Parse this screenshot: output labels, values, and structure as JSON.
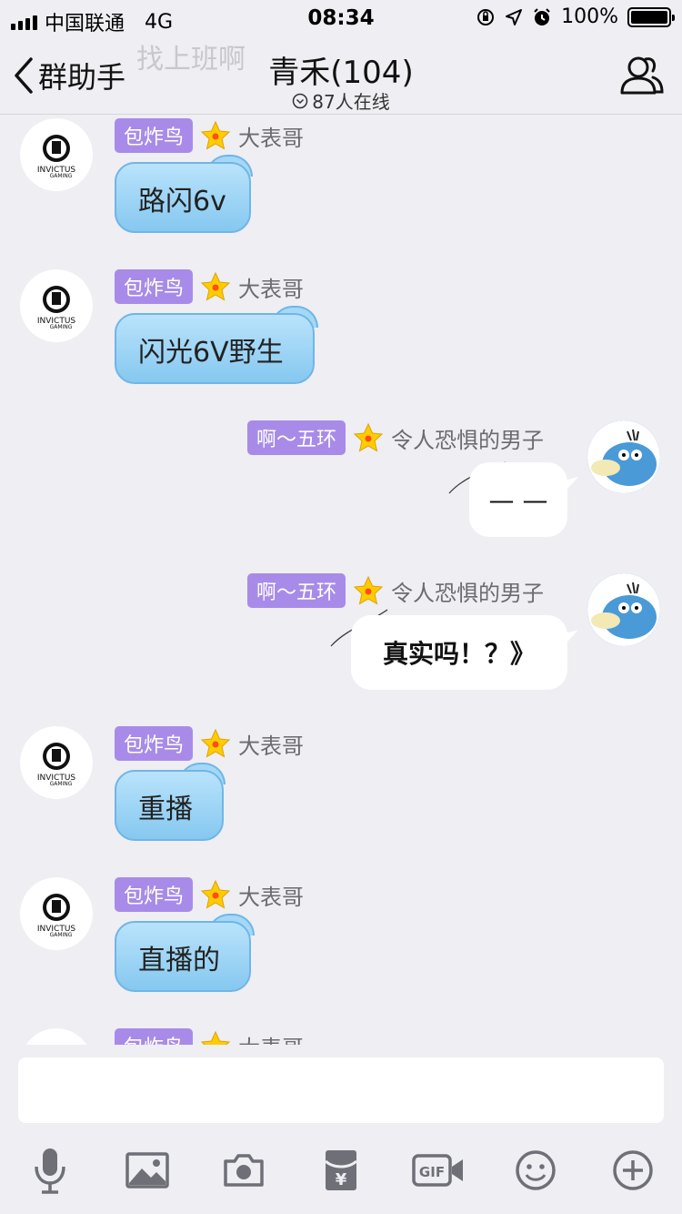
{
  "status_bar": {
    "carrier": "中国联通",
    "network": "4G",
    "time": "08:34",
    "battery": "100%"
  },
  "nav": {
    "ghost_text": "找上班啊",
    "back_label": "群助手",
    "title": "青禾(104)",
    "online": "87人在线"
  },
  "messages": [
    {
      "side": "left",
      "badge": "包炸鸟",
      "nick": "大表哥",
      "text": "路闪6v"
    },
    {
      "side": "left",
      "badge": "包炸鸟",
      "nick": "大表哥",
      "text": "闪光6V野生"
    },
    {
      "side": "right",
      "badge": "啊～五环",
      "nick": "令人恐惧的男子",
      "text": "— —"
    },
    {
      "side": "right",
      "badge": "啊～五环",
      "nick": "令人恐惧的男子",
      "text": "真实吗！？》"
    },
    {
      "side": "left",
      "badge": "包炸鸟",
      "nick": "大表哥",
      "text": "重播"
    },
    {
      "side": "left",
      "badge": "包炸鸟",
      "nick": "大表哥",
      "text": "直播的"
    },
    {
      "side": "left",
      "badge": "包炸鸟",
      "nick": "大表哥",
      "text": ""
    }
  ],
  "toolbar": {
    "icons": [
      "microphone-icon",
      "image-icon",
      "camera-icon",
      "red-packet-icon",
      "gif-icon",
      "emoji-icon",
      "plus-icon"
    ],
    "gif_label": "GIF",
    "red_packet_label": "¥"
  },
  "colors": {
    "badge": "#a88be8",
    "bubble_blue": "#9fd4f5",
    "background": "#eeeef3"
  }
}
